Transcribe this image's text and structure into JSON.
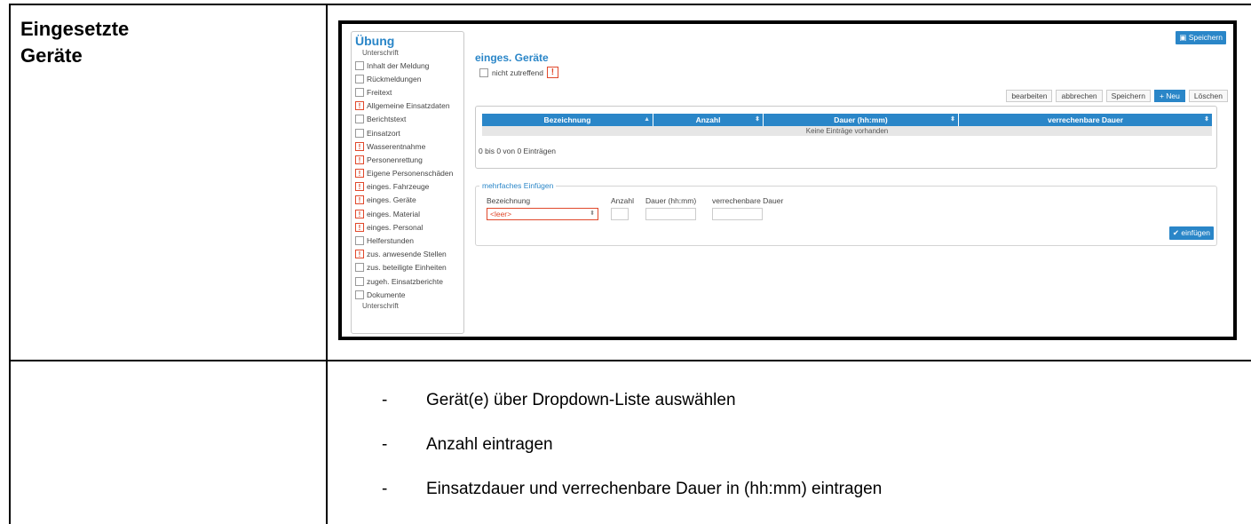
{
  "doc": {
    "heading_line1": "Eingesetzte",
    "heading_line2": "Geräte",
    "bullets": [
      {
        "dash": "-",
        "text": "Gerät(e) über Dropdown-Liste auswählen"
      },
      {
        "dash": "-",
        "text": "Anzahl eintragen"
      },
      {
        "dash": "-",
        "text": "Einsatzdauer und verrechenbare Dauer in (hh:mm) eintragen"
      }
    ]
  },
  "app": {
    "save_top": "Speichern",
    "sidebar": {
      "title": "Übung",
      "sub_top": "Unterschrift",
      "items": [
        {
          "label": "Inhalt der Meldung",
          "warn": false
        },
        {
          "label": "Rückmeldungen",
          "warn": false
        },
        {
          "label": "Freitext",
          "warn": false
        },
        {
          "label": "Allgemeine Einsatzdaten",
          "warn": true
        },
        {
          "label": "Berichtstext",
          "warn": false
        },
        {
          "label": "Einsatzort",
          "warn": false
        },
        {
          "label": "Wasserentnahme",
          "warn": true
        },
        {
          "label": "Personenrettung",
          "warn": true
        },
        {
          "label": "Eigene Personenschäden",
          "warn": true
        },
        {
          "label": "einges. Fahrzeuge",
          "warn": true
        },
        {
          "label": "einges. Geräte",
          "warn": true
        },
        {
          "label": "einges. Material",
          "warn": true
        },
        {
          "label": "einges. Personal",
          "warn": true
        },
        {
          "label": "Helferstunden",
          "warn": false
        },
        {
          "label": "zus. anwesende Stellen",
          "warn": true
        },
        {
          "label": "zus. beteiligte Einheiten",
          "warn": false
        },
        {
          "label": "zugeh. Einsatzberichte",
          "warn": false
        },
        {
          "label": "Dokumente",
          "warn": false
        }
      ],
      "sub_bottom": "Unterschrift"
    },
    "main": {
      "title": "einges. Geräte",
      "not_applicable": "nicht zutreffend",
      "warn_mark": "!",
      "toolbar": {
        "edit": "bearbeiten",
        "cancel": "abbrechen",
        "save": "Speichern",
        "new": "Neu",
        "delete": "Löschen"
      },
      "table": {
        "columns": [
          "Bezeichnung",
          "Anzahl",
          "Dauer (hh:mm)",
          "verrechenbare Dauer"
        ],
        "empty_text": "Keine Einträge vorhanden",
        "info": "0 bis 0 von 0 Einträgen"
      },
      "multi_insert": {
        "legend": "mehrfaches Einfügen",
        "label_name": "Bezeichnung",
        "label_count": "Anzahl",
        "label_duration": "Dauer (hh:mm)",
        "label_billable": "verrechenbare Dauer",
        "select_value": "<leer>",
        "insert_button": "einfügen"
      }
    },
    "colors": {
      "accent": "#2a86c8",
      "warning": "#e0482b"
    }
  }
}
